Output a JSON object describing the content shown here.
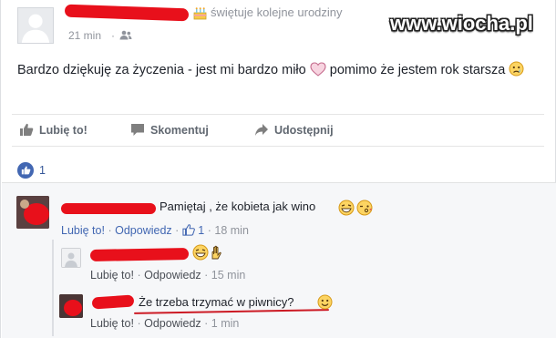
{
  "post": {
    "status": "świętuje kolejne urodziny",
    "watermark": "www.wiocha.pl",
    "time": "21 min",
    "text_part1": "Bardzo dziękuję za życzenia - jest mi bardzo miło",
    "text_part2": "pomimo że jestem rok starsza",
    "actions": {
      "like": "Lubię to!",
      "comment": "Skomentuj",
      "share": "Udostępnij"
    },
    "reaction_count": "1"
  },
  "comments": [
    {
      "text": "Pamiętaj , że kobieta jak wino",
      "like": "Lubię to!",
      "reply": "Odpowiedz",
      "sep": "·",
      "likes": "1",
      "time": "18 min"
    },
    {
      "text": "",
      "like": "Lubię to!",
      "reply": "Odpowiedz",
      "sep": "·",
      "time": "15 min"
    },
    {
      "text": "Że trzeba trzymać w piwnicy?",
      "like": "Lubię to!",
      "reply": "Odpowiedz",
      "sep": "·",
      "time": "1 min"
    }
  ],
  "icons": {
    "cake": "birthday-cake-icon",
    "friends": "friends-audience-icon",
    "like": "thumbs-up-icon",
    "comment": "speech-bubble-icon",
    "share": "share-arrow-icon",
    "heart": "heart-emoji-icon",
    "sad_face": "sad-face-emoji-icon",
    "grin": "grin-emoji-icon",
    "wink": "wink-kiss-emoji-icon",
    "smile": "smile-emoji-icon",
    "hand": "hand-emoji-icon"
  },
  "colors": {
    "redaction": "#e8101b",
    "link_blue": "#4267b2",
    "meta_gray": "#90949c"
  }
}
